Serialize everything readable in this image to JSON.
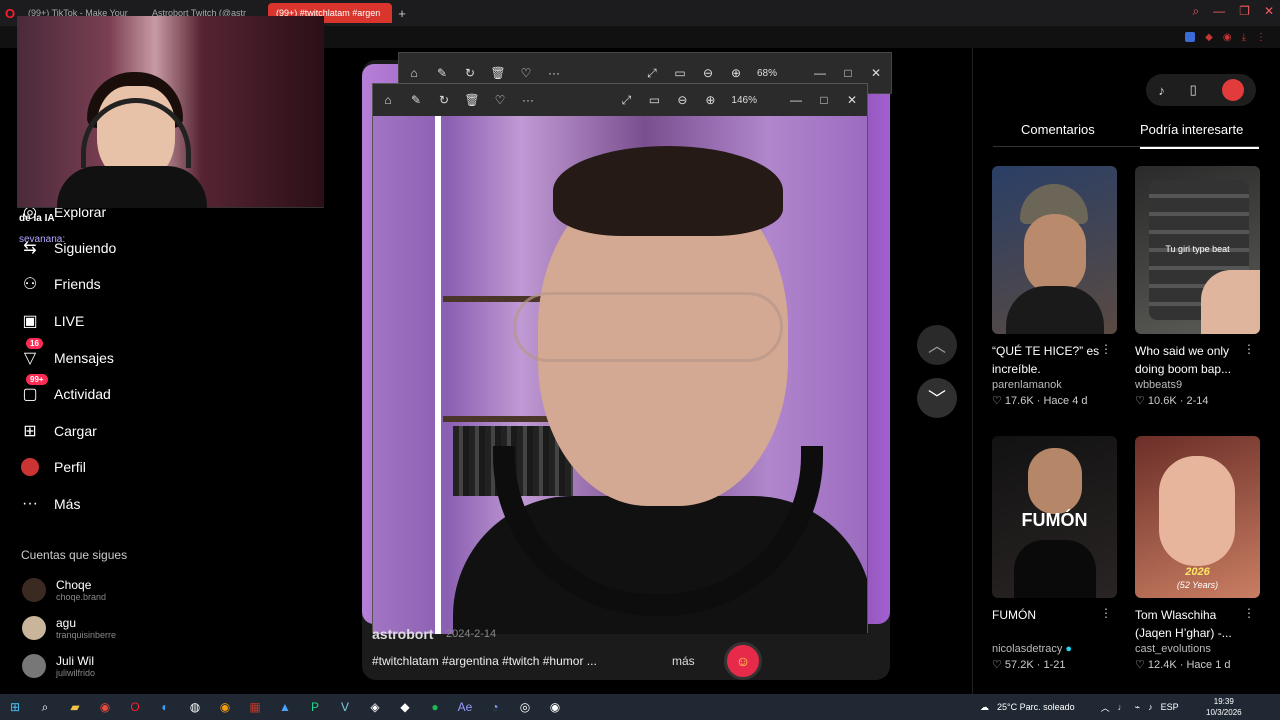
{
  "browser": {
    "tabs": [
      {
        "label": "(99+) TikTok - Make Your"
      },
      {
        "label": "Astrobort Twitch (@astr"
      },
      {
        "label": "(99+) #twitchlatam #argen"
      }
    ],
    "add_tab": "+"
  },
  "left_nav": {
    "overlay_text": "de la IA",
    "overlay_user": "sevanana:",
    "items": [
      {
        "label": "Explorar",
        "icon": "compass-icon"
      },
      {
        "label": "Siguiendo",
        "icon": "following-icon"
      },
      {
        "label": "Friends",
        "icon": "friends-icon"
      },
      {
        "label": "LIVE",
        "icon": "live-icon"
      },
      {
        "label": "Mensajes",
        "icon": "messages-icon",
        "badge": "16"
      },
      {
        "label": "Actividad",
        "icon": "activity-icon",
        "badge": "99+"
      },
      {
        "label": "Cargar",
        "icon": "upload-icon"
      },
      {
        "label": "Perfil",
        "icon": "profile-icon"
      },
      {
        "label": "Más",
        "icon": "more-icon"
      }
    ],
    "following_title": "Cuentas que sigues",
    "following": [
      {
        "name": "Choqe",
        "handle": "choqe.brand"
      },
      {
        "name": "agu",
        "handle": "tranquisinberre"
      },
      {
        "name": "Juli Wil",
        "handle": "juliwilfrido"
      }
    ]
  },
  "photo_viewer_back": {
    "zoom": "68%"
  },
  "photo_viewer_front": {
    "zoom": "146%"
  },
  "video": {
    "author": "astrobort",
    "date": "2024-2-14",
    "caption": "#twitchlatam #argentina #twitch #humor ...",
    "more": "más"
  },
  "right_panel": {
    "tabs": [
      {
        "label": "Comentarios",
        "active": false
      },
      {
        "label": "Podría interesarte",
        "active": true
      }
    ],
    "cards": [
      {
        "title": "“QUÉ TE HICE?” es increíble.",
        "author": "parenlamanok",
        "likes": "17.6K",
        "time": "Hace 4 d",
        "thumb_text": "",
        "colors": [
          "#2a3f66",
          "#5a4a42"
        ]
      },
      {
        "title": "Who said we only doing boom bap...",
        "author": "wbbeats9",
        "likes": "10.6K",
        "time": "2-14",
        "thumb_text": "Tu girl type beat",
        "colors": [
          "#2a2a2a",
          "#5c5c58"
        ]
      },
      {
        "title": "FUMÓN",
        "author": "nicolasdetracy",
        "likes": "57.2K",
        "time": "1-21",
        "thumb_text": "FUMÓN",
        "colors": [
          "#121212",
          "#2a2424"
        ]
      },
      {
        "title": "Tom Wlaschiha (Jaqen H’ghar) -...",
        "author": "cast_evolutions",
        "likes": "12.4K",
        "time": "Hace 1 d",
        "thumb_text": "2026",
        "thumb_sub": "(52 Years)",
        "colors": [
          "#6b2e28",
          "#c97e62"
        ]
      }
    ]
  },
  "taskbar": {
    "weather": "25°C  Parc. soleado",
    "lang": "ESP",
    "time": "19:39",
    "date": "10/3/2026"
  }
}
